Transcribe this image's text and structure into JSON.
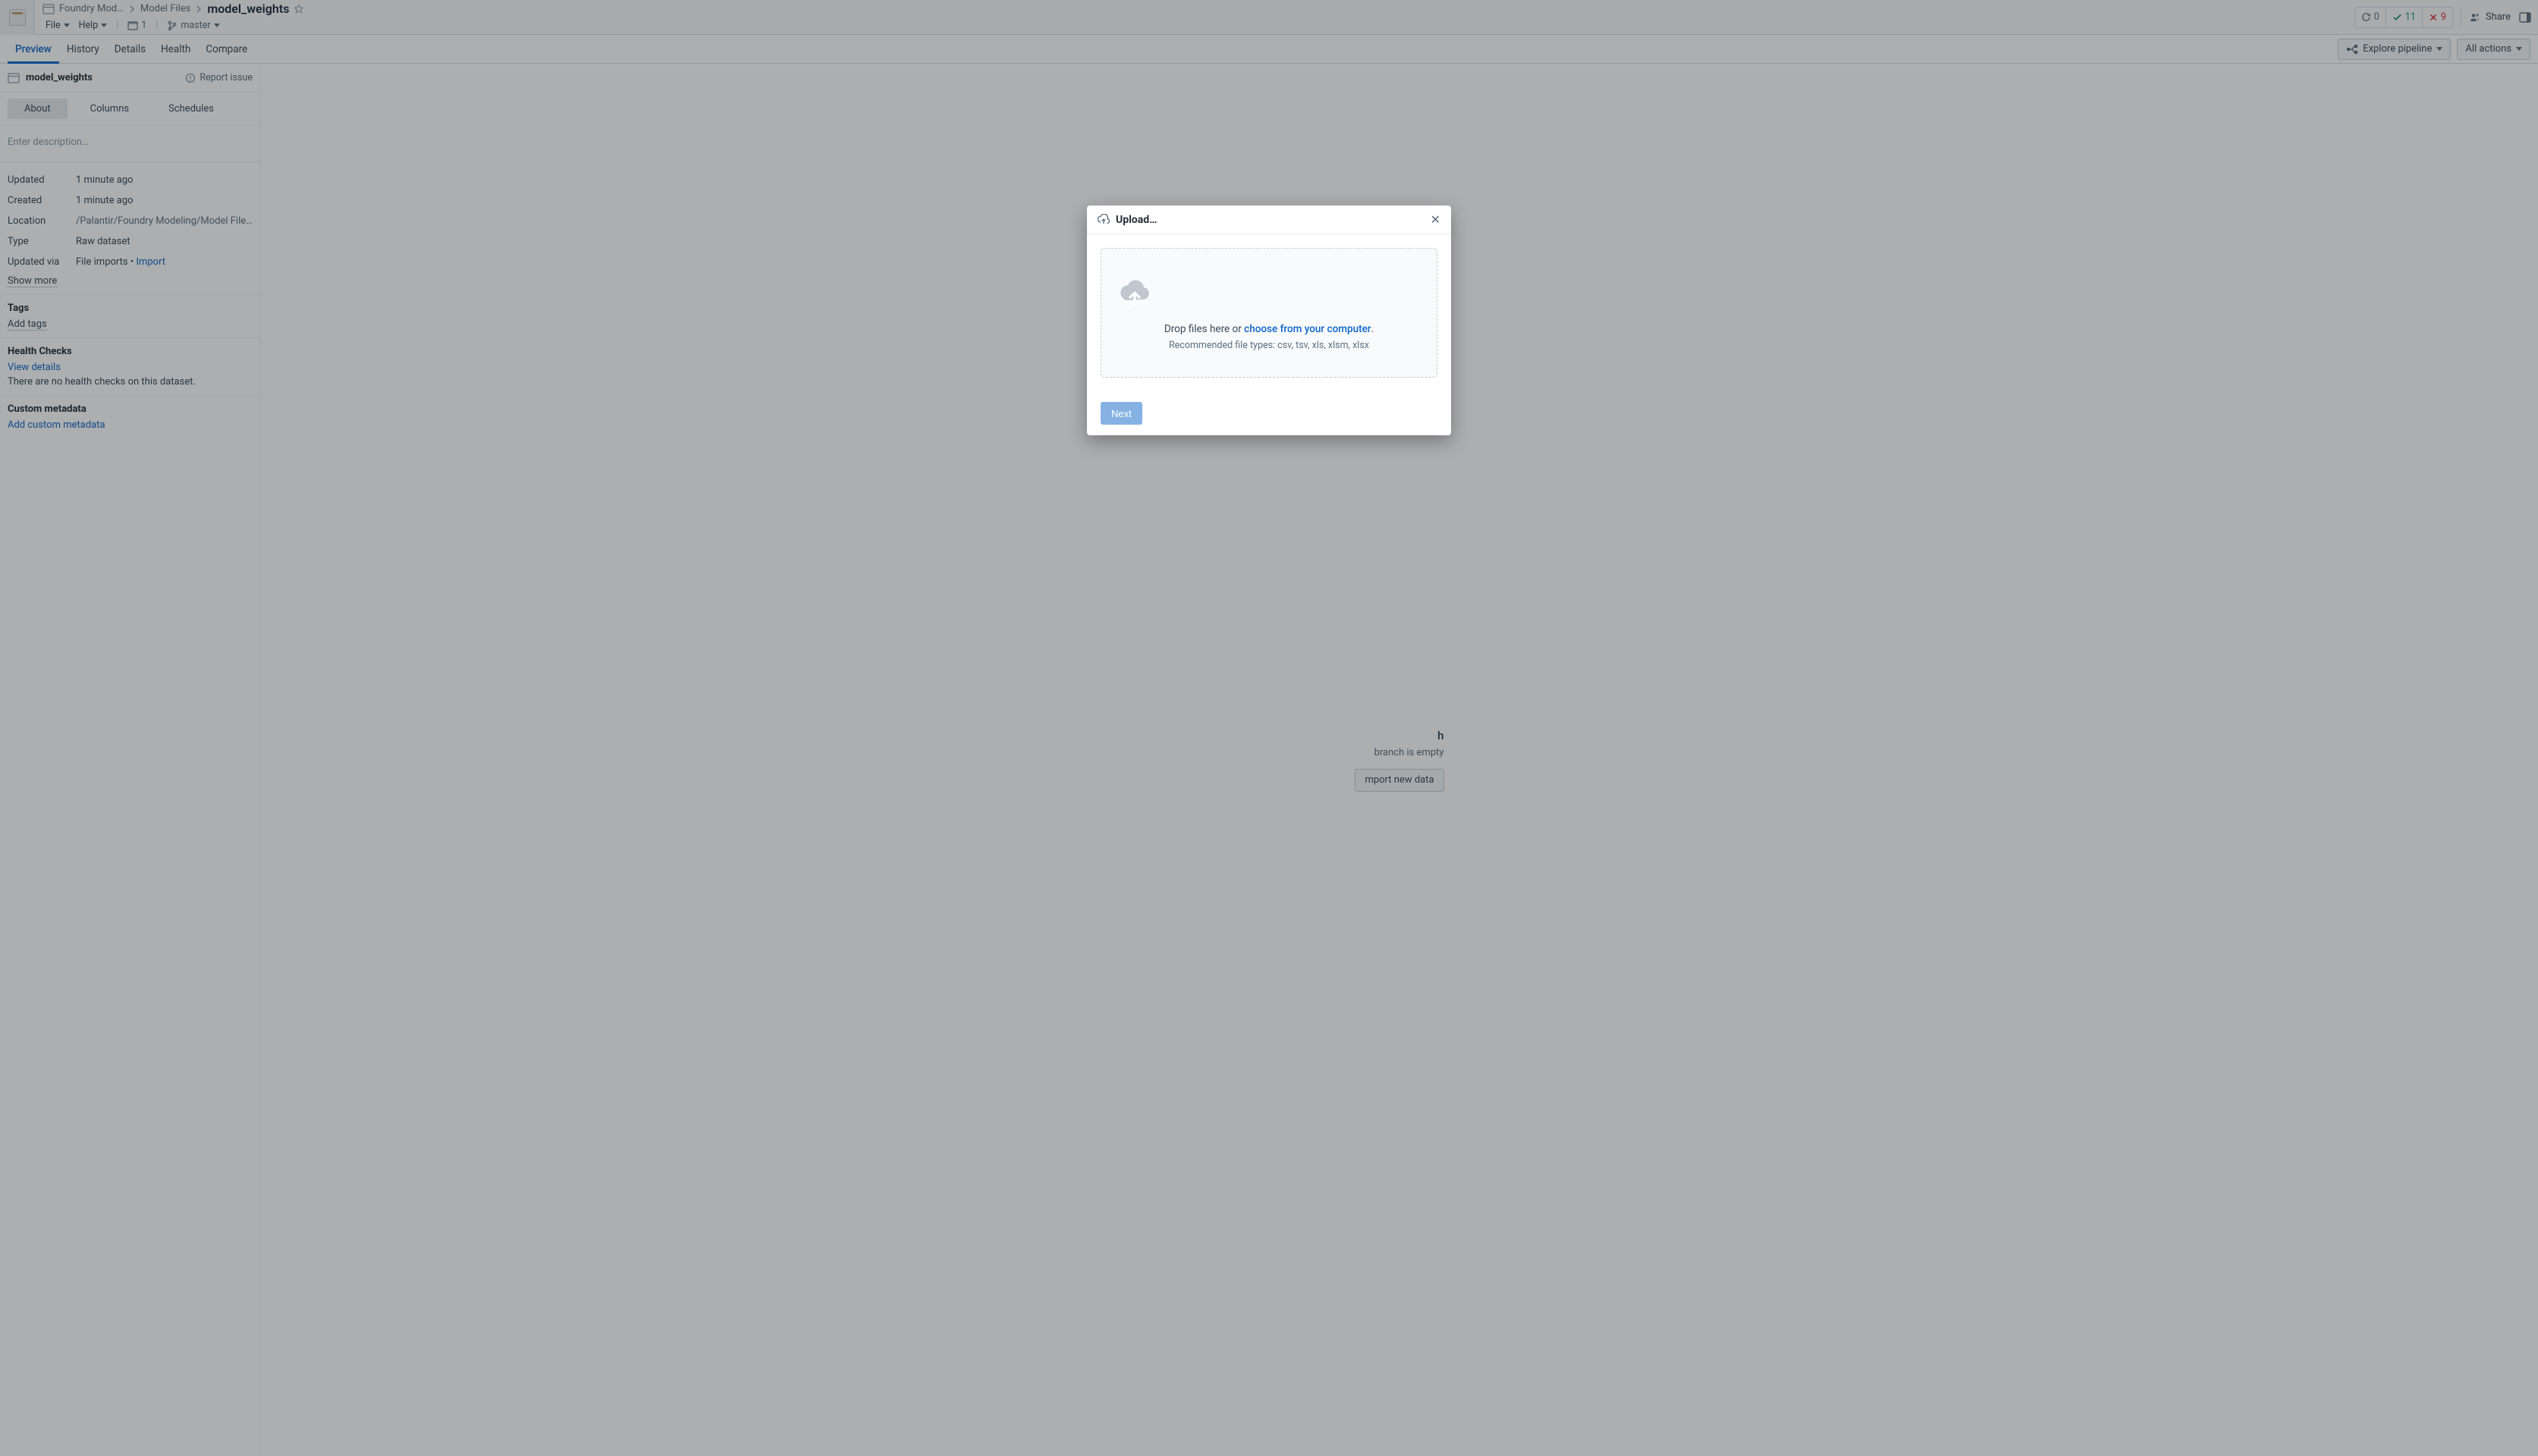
{
  "header": {
    "breadcrumbs": [
      "Foundry Mod…",
      "Model Files"
    ],
    "current": "model_weights",
    "menus": {
      "file": "File",
      "help": "Help"
    },
    "open_docs_count": "1",
    "branch": "master",
    "status": {
      "sync": "0",
      "checks_ok": "11",
      "checks_err": "9"
    },
    "share": "Share"
  },
  "tabs": {
    "items": [
      "Preview",
      "History",
      "Details",
      "Health",
      "Compare"
    ],
    "explore": "Explore pipeline",
    "all_actions": "All actions"
  },
  "sidebar": {
    "name": "model_weights",
    "report_issue": "Report issue",
    "side_tabs": [
      "About",
      "Columns",
      "Schedules"
    ],
    "desc_placeholder": "Enter description…",
    "meta": {
      "updated_k": "Updated",
      "updated_v": "1 minute ago",
      "created_k": "Created",
      "created_v": "1 minute ago",
      "location_k": "Location",
      "location_v": "/Palantir/Foundry Modeling/Model Files/m…",
      "type_k": "Type",
      "type_v": "Raw dataset",
      "updated_via_k": "Updated via",
      "updated_via_v": "File imports",
      "updated_via_sep": " • ",
      "import_link": "Import",
      "show_more": "Show more"
    },
    "tags": {
      "title": "Tags",
      "add": "Add tags"
    },
    "health": {
      "title": "Health Checks",
      "view": "View details",
      "msg": "There are no health checks on this dataset."
    },
    "custom": {
      "title": "Custom metadata",
      "add": "Add custom metadata"
    }
  },
  "empty": {
    "title_suffix": "h",
    "subtitle_suffix": "branch is empty",
    "import_btn_suffix": "mport new data"
  },
  "modal": {
    "title": "Upload…",
    "drop_prefix": "Drop files here or ",
    "choose": "choose from your computer",
    "drop_suffix": ".",
    "recommended": "Recommended file types: csv, tsv, xls, xlsm, xlsx",
    "next": "Next"
  }
}
